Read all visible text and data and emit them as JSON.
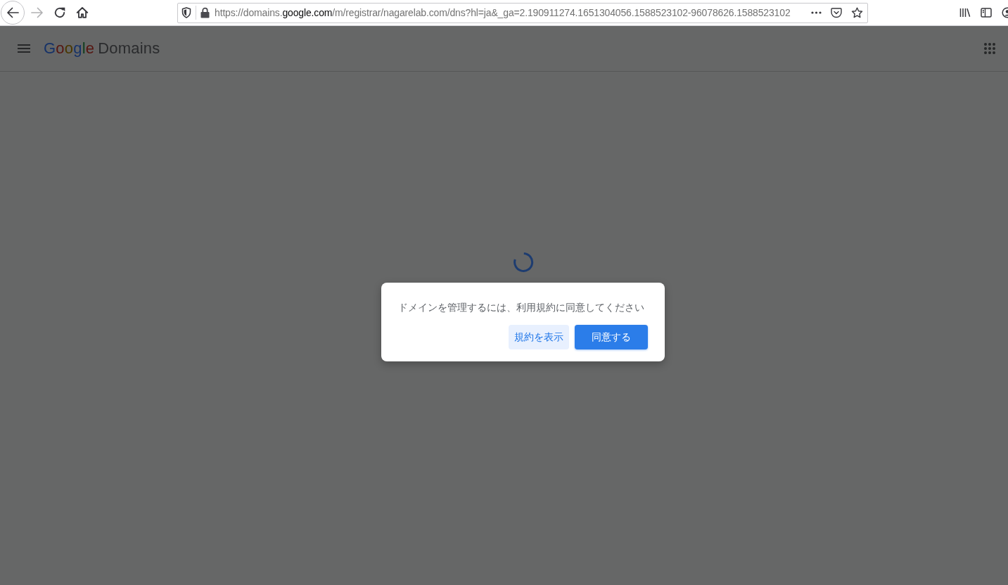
{
  "browser": {
    "back": {
      "disabled": false
    },
    "forward": {
      "disabled": true
    },
    "url": {
      "prefix": "https://domains.",
      "domain": "google.com",
      "path": "/m/registrar/nagarelab.com/dns?hl=ja&_ga=2.190911274.1651304056.1588523102-96078626.1588523102"
    }
  },
  "app_bar": {
    "logo_brand": "Google",
    "logo_product": "Domains"
  },
  "loading": true,
  "dialog": {
    "message": "ドメインを管理するには、利用規約に同意してください",
    "buttons": [
      {
        "label": "規約を表示",
        "kind": "secondary"
      },
      {
        "label": "同意する",
        "kind": "primary"
      }
    ]
  }
}
